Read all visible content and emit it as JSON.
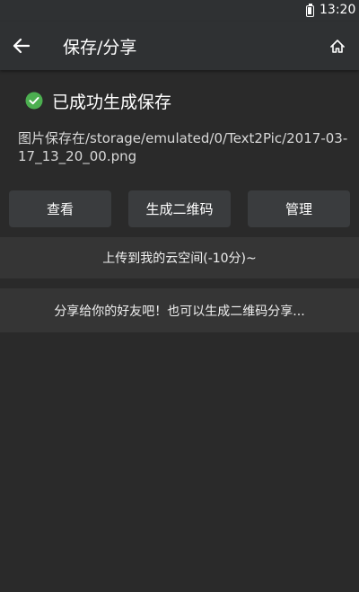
{
  "status_bar": {
    "time": "13:20",
    "battery_icon": "battery-charging-icon"
  },
  "app_bar": {
    "title": "保存/分享",
    "back_icon": "arrow-left-icon",
    "home_icon": "home-icon"
  },
  "result": {
    "status_icon": "check-circle-icon",
    "message": "已成功生成保存",
    "saved_path": "图片保存在/storage/emulated/0/Text2Pic/2017-03-17_13_20_00.png"
  },
  "actions": {
    "view_label": "查看",
    "qr_label": "生成二维码",
    "manage_label": "管理"
  },
  "upload": {
    "label": "上传到我的云空间(-10分)~"
  },
  "share": {
    "label": "分享给你的好友吧！也可以生成二维码分享..."
  },
  "colors": {
    "background": "#2a2a2a",
    "app_bar": "#2f3133",
    "button": "#3a3c3e",
    "bar": "#353535",
    "success_green": "#4caf50"
  }
}
